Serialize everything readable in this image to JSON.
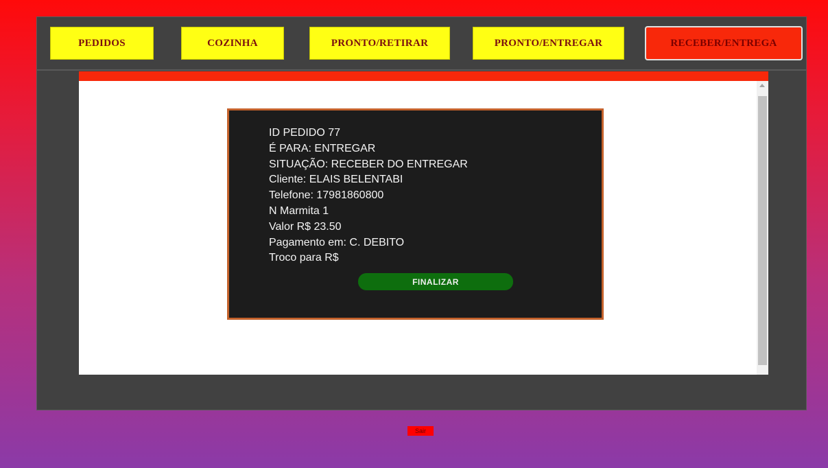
{
  "nav": {
    "tabs": [
      {
        "label": "PEDIDOS"
      },
      {
        "label": "COZINHA"
      },
      {
        "label": "PRONTO/RETIRAR"
      },
      {
        "label": "PRONTO/ENTREGAR"
      },
      {
        "label": "RECEBER/ENTREGA",
        "active": true
      }
    ]
  },
  "order": {
    "id_line": "ID PEDIDO 77",
    "para_line": "É PARA: ENTREGAR",
    "situacao_line": "SITUAÇÃO: RECEBER DO ENTREGAR",
    "cliente_line": "Cliente: ELAIS BELENTABI",
    "telefone_line": "Telefone: 17981860800",
    "marmita_line": "N Marmita 1",
    "valor_line": "Valor R$ 23.50",
    "pagamento_line": "Pagamento em: C. DEBITO",
    "troco_line": "Troco para R$",
    "finalize_label": "FINALIZAR"
  },
  "footer": {
    "sair_label": "Sair"
  },
  "colors": {
    "tab_bg": "#ffff14",
    "tab_active_bg": "#f8280a",
    "finalize_bg": "#0e6e0e",
    "card_border": "#c4622c"
  }
}
